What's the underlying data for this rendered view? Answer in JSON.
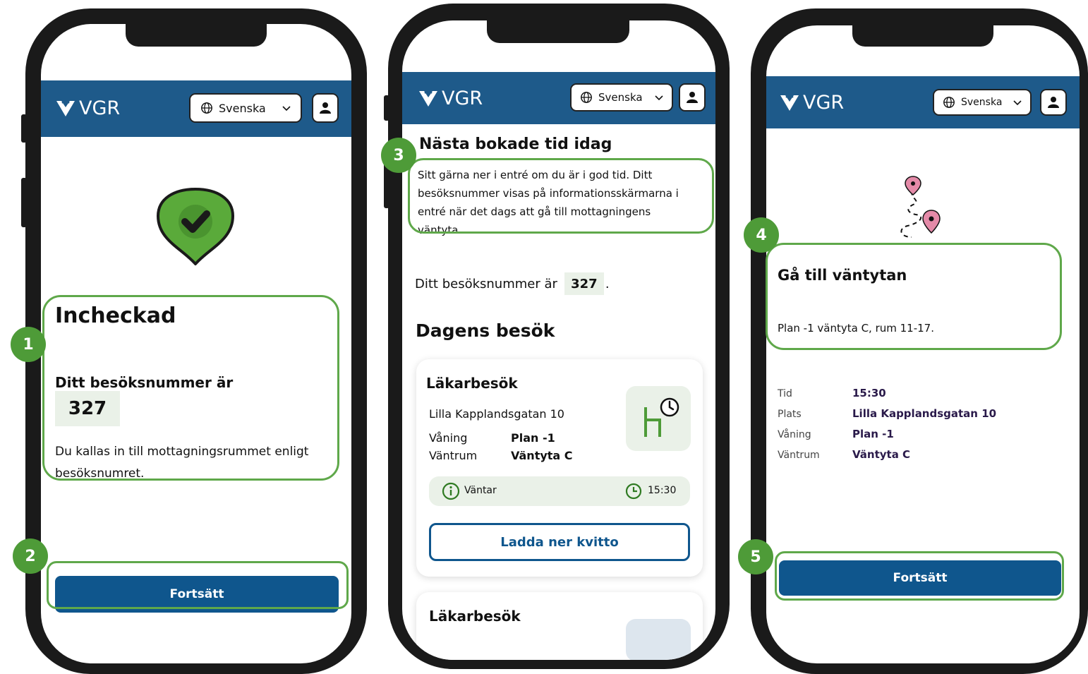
{
  "header": {
    "brand": "VGR",
    "language": "Svenska"
  },
  "screen1": {
    "title": "Incheckad",
    "number_label": "Ditt besöksnummer är",
    "number": "327",
    "info_line1": "Du kallas in till mottagningsrummet enligt",
    "info_line2": "besöksnumret.",
    "continue": "Fortsätt"
  },
  "screen2": {
    "heading": "Nästa bokade tid idag",
    "info_line1": "Sitt gärna ner i entré om du är i god tid. Ditt",
    "info_line2": "besöksnummer visas på informationsskärmarna i",
    "info_line3": "entré när det dags att gå till mottagningens",
    "info_line4": "väntyta.",
    "visit_number_prefix": "Ditt besöksnummer är",
    "visit_number": "327",
    "visit_number_suffix": ".",
    "section_title": "Dagens besök",
    "card": {
      "title": "Läkarbesök",
      "address": "Lilla Kapplandsgatan 10",
      "floor_label": "Våning",
      "floor_value": "Plan -1",
      "room_label": "Väntrum",
      "room_value": "Väntyta C",
      "status": "Väntar",
      "time": "15:30",
      "receipt_button": "Ladda ner kvitto"
    },
    "card2_title": "Läkarbesök"
  },
  "screen3": {
    "title": "Gå till väntytan",
    "location": "Plan -1 väntyta C, rum 11-17.",
    "rows": [
      {
        "label": "Tid",
        "value": "15:30"
      },
      {
        "label": "Plats",
        "value": "Lilla Kapplandsgatan 10"
      },
      {
        "label": "Våning",
        "value": "Plan -1"
      },
      {
        "label": "Väntrum",
        "value": "Väntyta C"
      }
    ],
    "continue": "Fortsätt"
  },
  "badges": [
    "1",
    "2",
    "3",
    "4",
    "5"
  ],
  "colors": {
    "header": "#1e5a8a",
    "primary": "#0f568d",
    "highlight": "#5fa84a",
    "badge": "#4e9b38",
    "number_bg": "#eaf1e8",
    "check": "#5aaa3a",
    "pin": "#e48aa8"
  },
  "icons": [
    "vgr-logo-icon",
    "globe-icon",
    "chevron-down-icon",
    "user-icon",
    "checkmark-heart-icon",
    "waiting-room-clock-icon",
    "info-icon",
    "clock-icon",
    "route-map-pin-icon"
  ]
}
